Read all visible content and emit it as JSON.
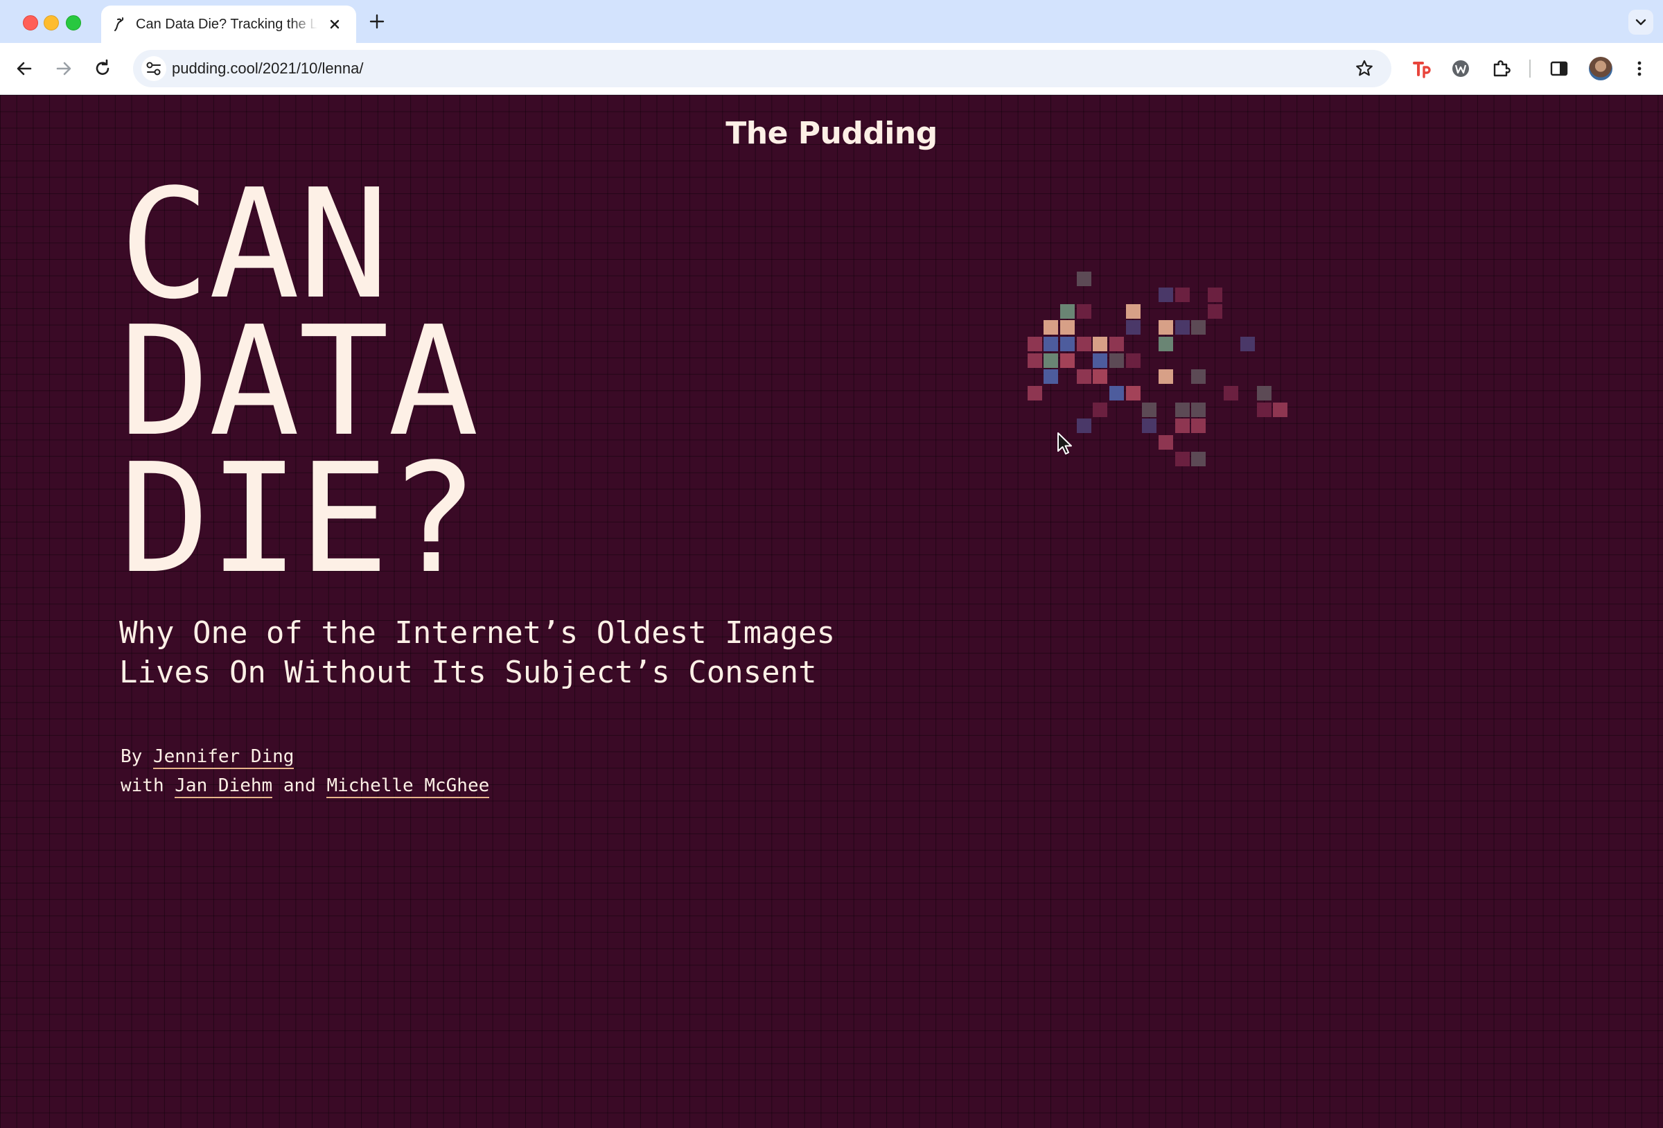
{
  "browser": {
    "tab": {
      "title": "Can Data Die? Tracking the Lenna Image",
      "favicon": "pudding-spoon-icon"
    },
    "url": "pudding.cool/2021/10/lenna/",
    "extensions": [
      "tp-extension-icon",
      "w-extension-icon",
      "puzzle-extensions-icon"
    ]
  },
  "page": {
    "brand": "The Pudding",
    "headline": [
      "CAN",
      "DATA",
      "DIE?"
    ],
    "subhead": [
      "Why One of the Internet’s Oldest Images",
      "Lives On Without Its Subject’s Consent"
    ],
    "byline": {
      "by": "By",
      "author": "Jennifer Ding",
      "with": "with",
      "coauthor1": "Jan Diehm",
      "and": "and",
      "coauthor2": "Michelle McGhee"
    },
    "colors": {
      "background": "#3a0a26",
      "text": "#fdf0e6",
      "link_underline": "#e7b48a"
    }
  }
}
